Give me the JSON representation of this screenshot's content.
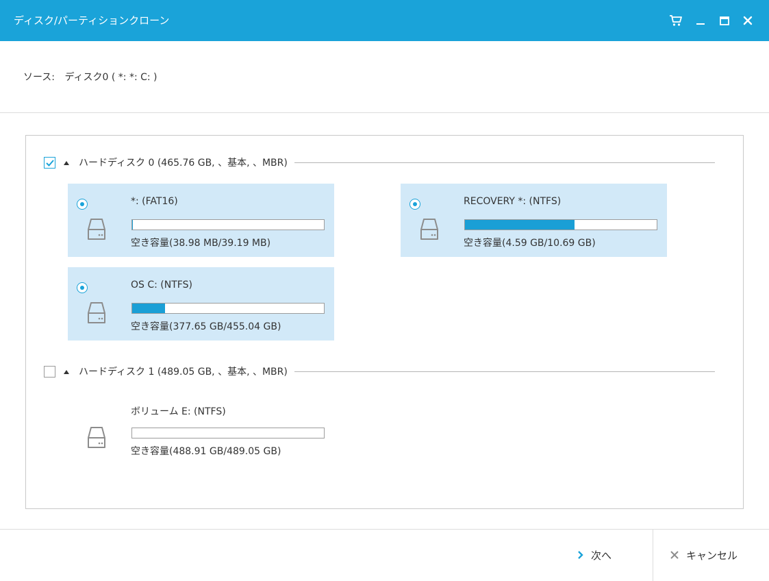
{
  "window": {
    "title": "ディスク/パーティションクローン",
    "controls": [
      "cart-icon",
      "minimize-icon",
      "maximize-icon",
      "close-icon"
    ]
  },
  "source": {
    "label": "ソース:",
    "value": "ディスク0 ( *: *: C: )"
  },
  "disks": [
    {
      "checked": true,
      "label": "ハードディスク 0 (465.76 GB, 、基本, 、MBR)",
      "partitions": [
        {
          "name": "*: (FAT16)",
          "free": "空き容量(38.98 MB/39.19 MB)",
          "used_fraction": 0.005,
          "selected": true
        },
        {
          "name": "RECOVERY *: (NTFS)",
          "free": "空き容量(4.59 GB/10.69 GB)",
          "used_fraction": 0.57,
          "selected": true
        },
        {
          "name": "OS C: (NTFS)",
          "free": "空き容量(377.65 GB/455.04 GB)",
          "used_fraction": 0.17,
          "selected": true
        }
      ]
    },
    {
      "checked": false,
      "label": "ハードディスク 1 (489.05 GB, 、基本, 、MBR)",
      "partitions": [
        {
          "name": "ボリューム E: (NTFS)",
          "free": "空き容量(488.91 GB/489.05 GB)",
          "used_fraction": 0.0,
          "selected": false
        }
      ]
    }
  ],
  "footer": {
    "next_label": "次へ",
    "cancel_label": "キャンセル"
  },
  "colors": {
    "accent": "#1aa3d9",
    "selected_bg": "#d2e9f8",
    "bar_fill": "#1a9fd6"
  }
}
